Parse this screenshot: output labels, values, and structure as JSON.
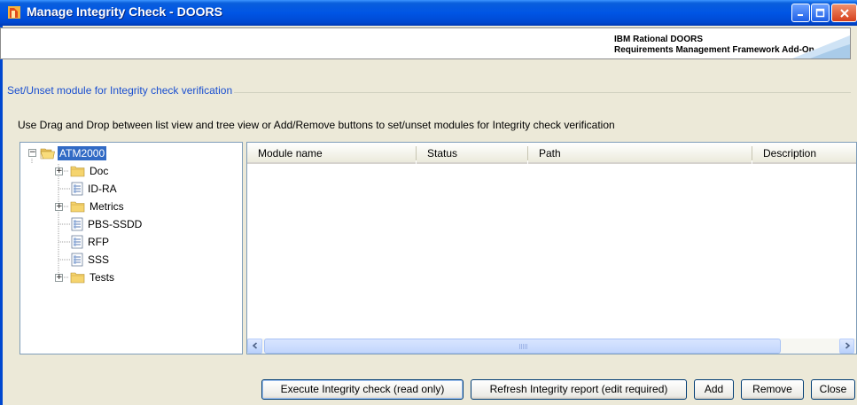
{
  "window": {
    "title": "Manage Integrity Check - DOORS",
    "buttons": {
      "minimize": "minimize-icon",
      "maximize": "maximize-icon",
      "close": "close-icon"
    }
  },
  "banner": {
    "line1": "IBM Rational DOORS",
    "line2": "Requirements Management Framework Add-On"
  },
  "group": {
    "legend": "Set/Unset module for Integrity check verification",
    "instruction": "Use Drag and Drop between list view and tree view or Add/Remove buttons to set/unset modules for Integrity check verification"
  },
  "tree": {
    "root": {
      "label": "ATM2000",
      "icon": "open-folder-icon",
      "expanded": true,
      "selected": true
    },
    "items": [
      {
        "label": "Doc",
        "type": "folder",
        "expandable": true
      },
      {
        "label": "ID-RA",
        "type": "module",
        "expandable": false
      },
      {
        "label": "Metrics",
        "type": "folder",
        "expandable": true
      },
      {
        "label": "PBS-SSDD",
        "type": "module",
        "expandable": false
      },
      {
        "label": "RFP",
        "type": "module",
        "expandable": false
      },
      {
        "label": "SSS",
        "type": "module",
        "expandable": false
      },
      {
        "label": "Tests",
        "type": "folder",
        "expandable": true
      }
    ]
  },
  "listview": {
    "columns": [
      "Module name",
      "Status",
      "Path",
      "Description"
    ],
    "rows": []
  },
  "buttons": {
    "execute": "Execute Integrity check (read only)",
    "refresh": "Refresh Integrity report (edit required)",
    "add": "Add",
    "remove": "Remove",
    "close": "Close"
  },
  "colors": {
    "titlebar": "#0055e5",
    "legend": "#1a4fd0",
    "selection": "#316ac5",
    "dialog_bg": "#ece9d8"
  }
}
